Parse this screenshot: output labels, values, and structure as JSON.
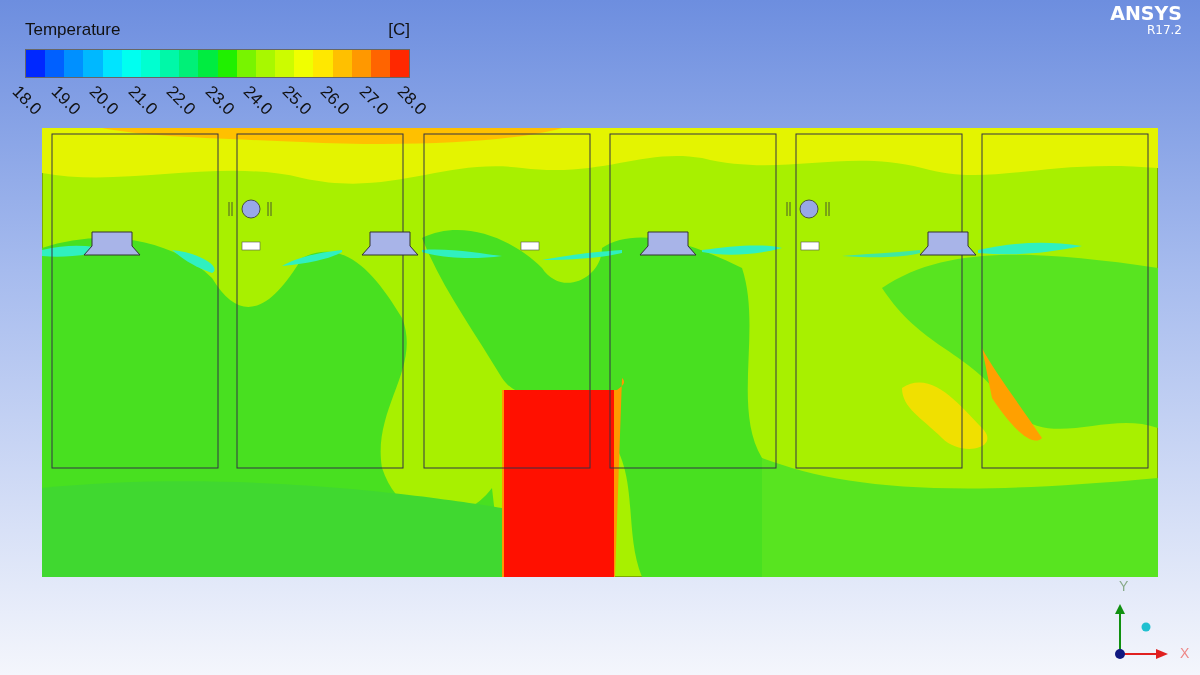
{
  "legend": {
    "title": "Temperature",
    "unit": "[C]",
    "bands": [
      {
        "color": "#0028ff"
      },
      {
        "color": "#0060ff"
      },
      {
        "color": "#0090ff"
      },
      {
        "color": "#00b8ff"
      },
      {
        "color": "#00e4ff"
      },
      {
        "color": "#00fff0"
      },
      {
        "color": "#00ffd0"
      },
      {
        "color": "#00f8a8"
      },
      {
        "color": "#00f078"
      },
      {
        "color": "#00ec40"
      },
      {
        "color": "#20f000"
      },
      {
        "color": "#78f400"
      },
      {
        "color": "#a8f800"
      },
      {
        "color": "#ccfc00"
      },
      {
        "color": "#f0ff00"
      },
      {
        "color": "#ffe800"
      },
      {
        "color": "#ffc000"
      },
      {
        "color": "#ff9800"
      },
      {
        "color": "#ff6400"
      },
      {
        "color": "#ff2800"
      }
    ],
    "ticks": [
      "18.0",
      "19.0",
      "20.0",
      "21.0",
      "22.0",
      "23.0",
      "24.0",
      "25.0",
      "26.0",
      "27.0",
      "28.0"
    ]
  },
  "logo": {
    "name": "ANSYS",
    "version": "R17.2"
  },
  "axes": {
    "y_label": "Y",
    "x_label": "X"
  }
}
